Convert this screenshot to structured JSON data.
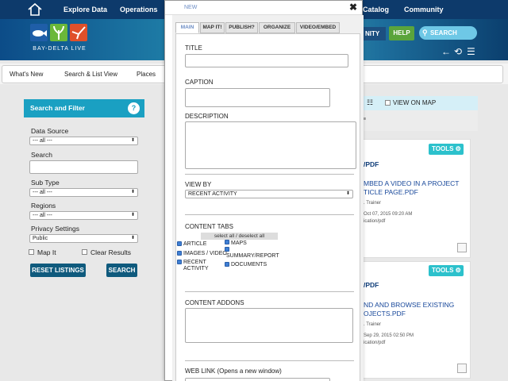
{
  "topnav": {
    "links": [
      "Explore Data",
      "Operations",
      "Catalog",
      "Community"
    ]
  },
  "banner": {
    "logo_text": "BAY-DELTA LIVE",
    "nav_partial": "NITY",
    "help": "HELP",
    "search": "SEARCH"
  },
  "subnav": {
    "items": [
      "What's New",
      "Search & List View",
      "Places"
    ]
  },
  "filter": {
    "title": "Search and Filter",
    "help_glyph": "?",
    "data_source_label": "Data Source",
    "data_source_value": "--- all ---",
    "search_label": "Search",
    "sub_type_label": "Sub Type",
    "sub_type_value": "--- all ---",
    "regions_label": "Regions",
    "regions_value": "--- all ---",
    "privacy_label": "Privacy Settings",
    "privacy_value": "Public",
    "map_it": "Map It",
    "clear_results": "Clear Results",
    "reset": "RESET LISTINGS",
    "search_btn": "SEARCH"
  },
  "results": {
    "view_on_map": "VIEW ON MAP",
    "cards": [
      {
        "tools": "TOOLS",
        "pdf": "/PDF",
        "title": "MBED A VIDEO IN A PROJECT TICLE PAGE.PDF",
        "author": ". Trainer",
        "date": "Oct 07, 2015 09:20 AM",
        "type": "ication/pdf"
      },
      {
        "tools": "TOOLS",
        "pdf": "/PDF",
        "title": "ND AND BROWSE EXISTING OJECTS.PDF",
        "author": ". Trainer",
        "date": "Sep 29, 2015 02:50 PM",
        "type": "ication/pdf"
      }
    ]
  },
  "modal": {
    "title": "NEW",
    "tabs": [
      "MAIN",
      "MAP IT!",
      "PUBLISH?",
      "ORGANIZE",
      "VIDEO/EMBED"
    ],
    "title_label": "TITLE",
    "caption_label": "CAPTION",
    "description_label": "DESCRIPTION",
    "view_by_label": "VIEW BY",
    "view_by_value": "RECENT ACTIVITY",
    "content_tabs_label": "CONTENT TABS",
    "select_all": "select all / deselect all",
    "checkboxes": [
      "ARTICLE",
      "MAPS",
      "IMAGES / VIDEO",
      "SUMMARY/REPORT",
      "RECENT ACTIVITY",
      "DOCUMENTS"
    ],
    "addons_label": "CONTENT ADDONS",
    "weblink_label": "WEB LINK (Opens a new window)"
  },
  "colors": {
    "topnav": "#0d3a6b",
    "accent": "#1aa0c2",
    "dark_button": "#0f5a7d",
    "tools": "#2cc1cc",
    "help": "#5aa43c"
  }
}
